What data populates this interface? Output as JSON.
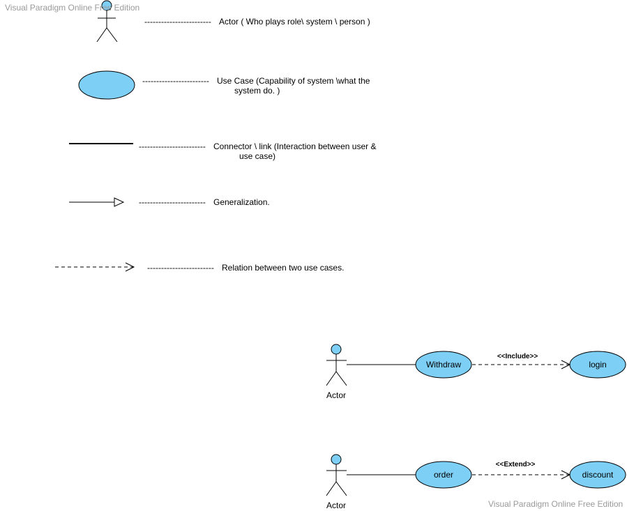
{
  "watermark": {
    "top": "Visual Paradigm Online Free Edition",
    "bottom": "Visual Paradigm Online Free Edition"
  },
  "legend": {
    "actor": {
      "dashes": "------------------------",
      "text": "Actor ( Who plays role\\ system \\ person )"
    },
    "use_case": {
      "dashes": "------------------------",
      "text": "Use Case (Capability of  system \\what the",
      "text_cont": "system do. )"
    },
    "connector": {
      "dashes": "------------------------",
      "text": "Connector \\ link (Interaction between user &",
      "text_cont": "use case)"
    },
    "generalization": {
      "dashes": "------------------------",
      "text": "Generalization."
    },
    "relation": {
      "dashes": "------------------------",
      "text": "Relation between two use cases."
    }
  },
  "example_include": {
    "actor_label": "Actor",
    "base_use_case": "Withdraw",
    "target_use_case": "login",
    "stereotype": "<<Include>>"
  },
  "example_extend": {
    "actor_label": "Actor",
    "base_use_case": "order",
    "target_use_case": "discount",
    "stereotype": "<<Extend>>"
  },
  "colors": {
    "use_case_fill": "#7dcff5",
    "actor_head_fill": "#7dcff5",
    "stroke": "#000000",
    "watermark": "#9a9a9a"
  }
}
